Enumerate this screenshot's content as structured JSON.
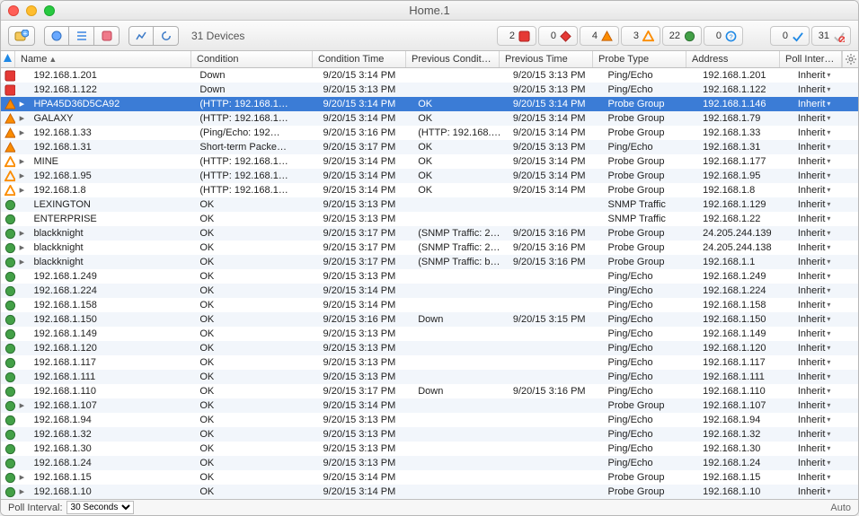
{
  "window": {
    "title": "Home.1"
  },
  "toolbar": {
    "device_count_label": "31 Devices"
  },
  "status_summary": {
    "down": 2,
    "critical": 0,
    "alarm": 4,
    "warning": 3,
    "ok": 22,
    "unknown": 0,
    "acked": 0,
    "unacked": 31
  },
  "columns": [
    "Name",
    "Condition",
    "Condition Time",
    "Previous Conditi…",
    "Previous Time",
    "Probe Type",
    "Address",
    "Poll Interval"
  ],
  "footer": {
    "poll_interval_label": "Poll Interval:",
    "poll_interval_value": "30 Seconds",
    "auto_label": "Auto"
  },
  "inherit_label": "Inherit",
  "status_icons": {
    "down": {
      "shape": "square",
      "fill": "#e53935",
      "stroke": "#a81f1c"
    },
    "alarm": {
      "shape": "triangle",
      "fill": "#fb8c00",
      "stroke": "#c65f00"
    },
    "warning": {
      "shape": "triangle",
      "fill": "none",
      "stroke": "#fb8c00"
    },
    "ok": {
      "shape": "circle",
      "fill": "#43a047",
      "stroke": "#2a7030"
    }
  },
  "rows": [
    {
      "status": "down",
      "expand": false,
      "name": "192.168.1.201",
      "condition": "Down",
      "cond_time": "9/20/15 3:14 PM",
      "prev_cond": "",
      "prev_time": "9/20/15 3:13 PM",
      "probe": "Ping/Echo",
      "address": "192.168.1.201",
      "selected": false
    },
    {
      "status": "down",
      "expand": false,
      "name": "192.168.1.122",
      "condition": "Down",
      "cond_time": "9/20/15 3:13 PM",
      "prev_cond": "",
      "prev_time": "9/20/15 3:13 PM",
      "probe": "Ping/Echo",
      "address": "192.168.1.122",
      "selected": false
    },
    {
      "status": "alarm",
      "expand": true,
      "name": "HPA45D36D5CA92",
      "condition": "(HTTP: 192.168.1…",
      "cond_time": "9/20/15 3:14 PM",
      "prev_cond": "OK",
      "prev_time": "9/20/15 3:14 PM",
      "probe": "Probe Group",
      "address": "192.168.1.146",
      "selected": true
    },
    {
      "status": "alarm",
      "expand": true,
      "name": "GALAXY",
      "condition": "(HTTP: 192.168.1…",
      "cond_time": "9/20/15 3:14 PM",
      "prev_cond": "OK",
      "prev_time": "9/20/15 3:14 PM",
      "probe": "Probe Group",
      "address": "192.168.1.79",
      "selected": false
    },
    {
      "status": "alarm",
      "expand": true,
      "name": "192.168.1.33",
      "condition": "(Ping/Echo: 192…",
      "cond_time": "9/20/15 3:16 PM",
      "prev_cond": "(HTTP: 192.168.1…",
      "prev_time": "9/20/15 3:14 PM",
      "probe": "Probe Group",
      "address": "192.168.1.33",
      "selected": false
    },
    {
      "status": "alarm",
      "expand": false,
      "name": "192.168.1.31",
      "condition": "Short-term Packe…",
      "cond_time": "9/20/15 3:17 PM",
      "prev_cond": "OK",
      "prev_time": "9/20/15 3:13 PM",
      "probe": "Ping/Echo",
      "address": "192.168.1.31",
      "selected": false
    },
    {
      "status": "warning",
      "expand": true,
      "name": "MINE",
      "condition": "(HTTP: 192.168.1…",
      "cond_time": "9/20/15 3:14 PM",
      "prev_cond": "OK",
      "prev_time": "9/20/15 3:14 PM",
      "probe": "Probe Group",
      "address": "192.168.1.177",
      "selected": false
    },
    {
      "status": "warning",
      "expand": true,
      "name": "192.168.1.95",
      "condition": "(HTTP: 192.168.1…",
      "cond_time": "9/20/15 3:14 PM",
      "prev_cond": "OK",
      "prev_time": "9/20/15 3:14 PM",
      "probe": "Probe Group",
      "address": "192.168.1.95",
      "selected": false
    },
    {
      "status": "warning",
      "expand": true,
      "name": "192.168.1.8",
      "condition": "(HTTP: 192.168.1…",
      "cond_time": "9/20/15 3:14 PM",
      "prev_cond": "OK",
      "prev_time": "9/20/15 3:14 PM",
      "probe": "Probe Group",
      "address": "192.168.1.8",
      "selected": false
    },
    {
      "status": "ok",
      "expand": false,
      "name": "LEXINGTON",
      "condition": "OK",
      "cond_time": "9/20/15 3:13 PM",
      "prev_cond": "",
      "prev_time": "",
      "probe": "SNMP Traffic",
      "address": "192.168.1.129",
      "selected": false
    },
    {
      "status": "ok",
      "expand": false,
      "name": "ENTERPRISE",
      "condition": "OK",
      "cond_time": "9/20/15 3:13 PM",
      "prev_cond": "",
      "prev_time": "",
      "probe": "SNMP Traffic",
      "address": "192.168.1.22",
      "selected": false
    },
    {
      "status": "ok",
      "expand": true,
      "name": "blackknight",
      "condition": "OK",
      "cond_time": "9/20/15 3:17 PM",
      "prev_cond": "(SNMP Traffic: 24…",
      "prev_time": "9/20/15 3:16 PM",
      "probe": "Probe Group",
      "address": "24.205.244.139",
      "selected": false
    },
    {
      "status": "ok",
      "expand": true,
      "name": "blackknight",
      "condition": "OK",
      "cond_time": "9/20/15 3:17 PM",
      "prev_cond": "(SNMP Traffic: 24…",
      "prev_time": "9/20/15 3:16 PM",
      "probe": "Probe Group",
      "address": "24.205.244.138",
      "selected": false
    },
    {
      "status": "ok",
      "expand": true,
      "name": "blackknight",
      "condition": "OK",
      "cond_time": "9/20/15 3:17 PM",
      "prev_cond": "(SNMP Traffic: bla…",
      "prev_time": "9/20/15 3:16 PM",
      "probe": "Probe Group",
      "address": "192.168.1.1",
      "selected": false
    },
    {
      "status": "ok",
      "expand": false,
      "name": "192.168.1.249",
      "condition": "OK",
      "cond_time": "9/20/15 3:13 PM",
      "prev_cond": "",
      "prev_time": "",
      "probe": "Ping/Echo",
      "address": "192.168.1.249",
      "selected": false
    },
    {
      "status": "ok",
      "expand": false,
      "name": "192.168.1.224",
      "condition": "OK",
      "cond_time": "9/20/15 3:14 PM",
      "prev_cond": "",
      "prev_time": "",
      "probe": "Ping/Echo",
      "address": "192.168.1.224",
      "selected": false
    },
    {
      "status": "ok",
      "expand": false,
      "name": "192.168.1.158",
      "condition": "OK",
      "cond_time": "9/20/15 3:14 PM",
      "prev_cond": "",
      "prev_time": "",
      "probe": "Ping/Echo",
      "address": "192.168.1.158",
      "selected": false
    },
    {
      "status": "ok",
      "expand": false,
      "name": "192.168.1.150",
      "condition": "OK",
      "cond_time": "9/20/15 3:16 PM",
      "prev_cond": "Down",
      "prev_time": "9/20/15 3:15 PM",
      "probe": "Ping/Echo",
      "address": "192.168.1.150",
      "selected": false
    },
    {
      "status": "ok",
      "expand": false,
      "name": "192.168.1.149",
      "condition": "OK",
      "cond_time": "9/20/15 3:13 PM",
      "prev_cond": "",
      "prev_time": "",
      "probe": "Ping/Echo",
      "address": "192.168.1.149",
      "selected": false
    },
    {
      "status": "ok",
      "expand": false,
      "name": "192.168.1.120",
      "condition": "OK",
      "cond_time": "9/20/15 3:13 PM",
      "prev_cond": "",
      "prev_time": "",
      "probe": "Ping/Echo",
      "address": "192.168.1.120",
      "selected": false
    },
    {
      "status": "ok",
      "expand": false,
      "name": "192.168.1.117",
      "condition": "OK",
      "cond_time": "9/20/15 3:13 PM",
      "prev_cond": "",
      "prev_time": "",
      "probe": "Ping/Echo",
      "address": "192.168.1.117",
      "selected": false
    },
    {
      "status": "ok",
      "expand": false,
      "name": "192.168.1.111",
      "condition": "OK",
      "cond_time": "9/20/15 3:13 PM",
      "prev_cond": "",
      "prev_time": "",
      "probe": "Ping/Echo",
      "address": "192.168.1.111",
      "selected": false
    },
    {
      "status": "ok",
      "expand": false,
      "name": "192.168.1.110",
      "condition": "OK",
      "cond_time": "9/20/15 3:17 PM",
      "prev_cond": "Down",
      "prev_time": "9/20/15 3:16 PM",
      "probe": "Ping/Echo",
      "address": "192.168.1.110",
      "selected": false
    },
    {
      "status": "ok",
      "expand": true,
      "name": "192.168.1.107",
      "condition": "OK",
      "cond_time": "9/20/15 3:14 PM",
      "prev_cond": "",
      "prev_time": "",
      "probe": "Probe Group",
      "address": "192.168.1.107",
      "selected": false
    },
    {
      "status": "ok",
      "expand": false,
      "name": "192.168.1.94",
      "condition": "OK",
      "cond_time": "9/20/15 3:13 PM",
      "prev_cond": "",
      "prev_time": "",
      "probe": "Ping/Echo",
      "address": "192.168.1.94",
      "selected": false
    },
    {
      "status": "ok",
      "expand": false,
      "name": "192.168.1.32",
      "condition": "OK",
      "cond_time": "9/20/15 3:13 PM",
      "prev_cond": "",
      "prev_time": "",
      "probe": "Ping/Echo",
      "address": "192.168.1.32",
      "selected": false
    },
    {
      "status": "ok",
      "expand": false,
      "name": "192.168.1.30",
      "condition": "OK",
      "cond_time": "9/20/15 3:13 PM",
      "prev_cond": "",
      "prev_time": "",
      "probe": "Ping/Echo",
      "address": "192.168.1.30",
      "selected": false
    },
    {
      "status": "ok",
      "expand": false,
      "name": "192.168.1.24",
      "condition": "OK",
      "cond_time": "9/20/15 3:13 PM",
      "prev_cond": "",
      "prev_time": "",
      "probe": "Ping/Echo",
      "address": "192.168.1.24",
      "selected": false
    },
    {
      "status": "ok",
      "expand": true,
      "name": "192.168.1.15",
      "condition": "OK",
      "cond_time": "9/20/15 3:14 PM",
      "prev_cond": "",
      "prev_time": "",
      "probe": "Probe Group",
      "address": "192.168.1.15",
      "selected": false
    },
    {
      "status": "ok",
      "expand": true,
      "name": "192.168.1.10",
      "condition": "OK",
      "cond_time": "9/20/15 3:14 PM",
      "prev_cond": "",
      "prev_time": "",
      "probe": "Probe Group",
      "address": "192.168.1.10",
      "selected": false
    }
  ]
}
